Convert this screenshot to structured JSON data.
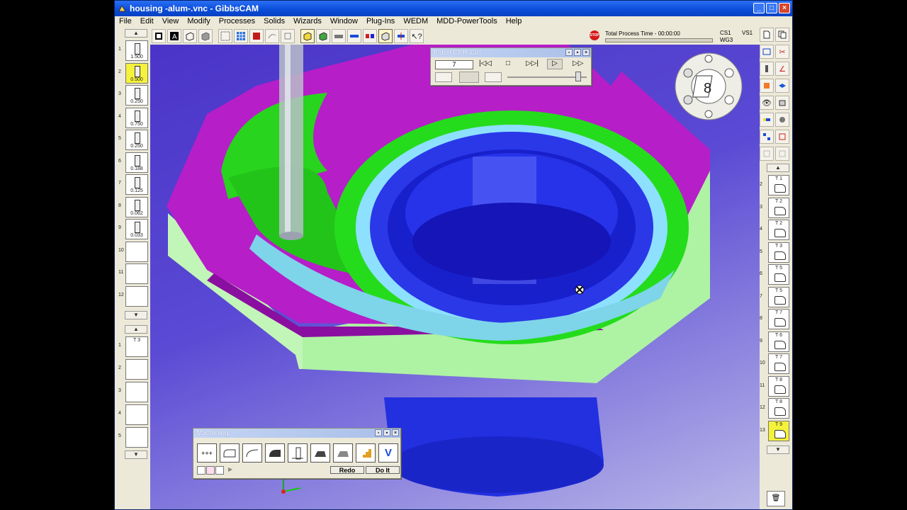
{
  "window": {
    "title": "housing -alum-.vnc - GibbsCAM",
    "min": "_",
    "max": "□",
    "close": "×"
  },
  "menu": [
    "File",
    "Edit",
    "View",
    "Modify",
    "Processes",
    "Solids",
    "Wizards",
    "Window",
    "Plug-Ins",
    "WEDM",
    "MDD-PowerTools",
    "Help"
  ],
  "status": {
    "stop": "STOP",
    "process_time": "Total Process Time - 00:00:00",
    "cs": "CS1",
    "wg": "WG3",
    "vs": "VS1"
  },
  "left_tools": [
    {
      "num": "1",
      "val": "1.500"
    },
    {
      "num": "2",
      "val": "0.500",
      "selected": true
    },
    {
      "num": "3",
      "val": "0.250"
    },
    {
      "num": "4",
      "val": "0.750"
    },
    {
      "num": "5",
      "val": "0.250"
    },
    {
      "num": "6",
      "val": "0.188"
    },
    {
      "num": "7",
      "val": "0.125"
    },
    {
      "num": "8",
      "val": "0.062"
    },
    {
      "num": "9",
      "val": "0.033"
    },
    {
      "num": "10",
      "val": ""
    },
    {
      "num": "11",
      "val": ""
    },
    {
      "num": "12",
      "val": ""
    }
  ],
  "left_ops": [
    {
      "num": "1",
      "label": "T 3"
    },
    {
      "num": "2",
      "label": ""
    },
    {
      "num": "3",
      "label": ""
    },
    {
      "num": "4",
      "label": ""
    },
    {
      "num": "5",
      "label": ""
    }
  ],
  "right_ops": [
    {
      "num": "2",
      "label": "T 1"
    },
    {
      "num": "3",
      "label": "T 2"
    },
    {
      "num": "4",
      "label": "T 2"
    },
    {
      "num": "5",
      "label": "T 3"
    },
    {
      "num": "6",
      "label": "T 5"
    },
    {
      "num": "7",
      "label": "T 5"
    },
    {
      "num": "8",
      "label": "T 7"
    },
    {
      "num": "9",
      "label": "T 6"
    },
    {
      "num": "10",
      "label": "T 7"
    },
    {
      "num": "11",
      "label": "T 8"
    },
    {
      "num": "12",
      "label": "T 8"
    },
    {
      "num": "13",
      "label": "T 9",
      "selected": true
    }
  ],
  "flash": {
    "title": "Flash CPR Cut",
    "value": "7",
    "rewind": "|◁◁",
    "stop": "□",
    "step": "▷▷|",
    "play": "▷",
    "ff": "▷▷"
  },
  "machining": {
    "title": "Machining",
    "redo": "Redo",
    "doit": "Do It",
    "v": "V",
    "drill": "+++"
  },
  "colors": {
    "purple_top": "#b21cc4",
    "green_feature": "#22e01c",
    "blue_bore": "#1a22d8",
    "side_green": "#b6f5b0"
  }
}
